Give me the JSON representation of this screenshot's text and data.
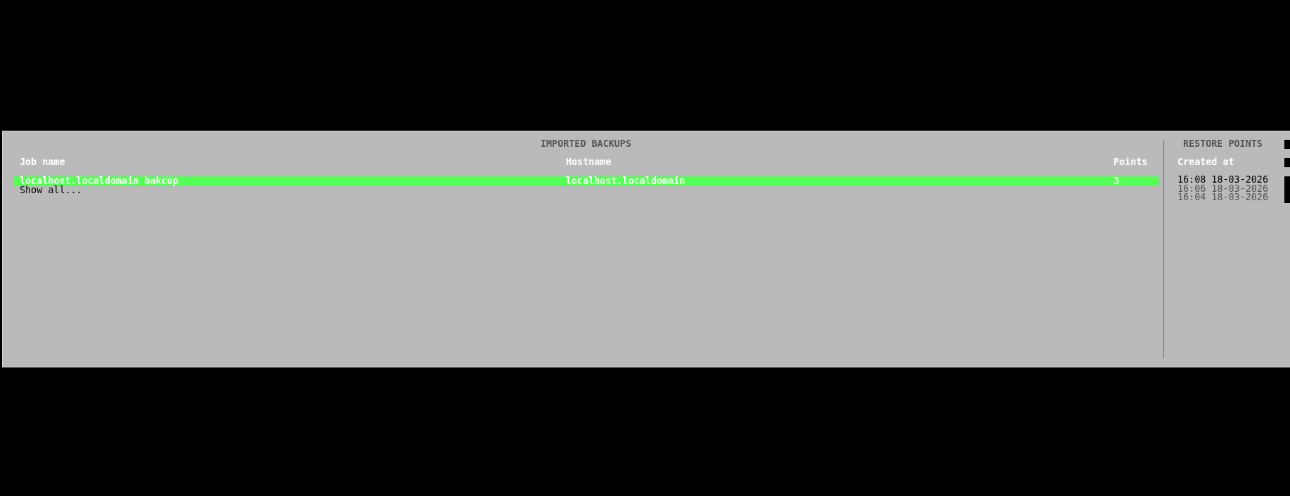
{
  "imported_backups": {
    "title": "IMPORTED BACKUPS",
    "columns": [
      "Job name",
      "Hostname",
      "Points"
    ],
    "rows": [
      {
        "cells": [
          "localhost.localdomain bakcup",
          "localhost.localdomain",
          "3"
        ],
        "selected": true
      }
    ],
    "show_all": "Show all..."
  },
  "restore_points": {
    "title": "RESTORE POINTS",
    "column": "Created at",
    "items": [
      {
        "label": "16:08 18-03-2026",
        "selected": true
      },
      {
        "label": "16:06 18-03-2026",
        "selected": false
      },
      {
        "label": "16:04 18-03-2026",
        "selected": false
      }
    ]
  }
}
